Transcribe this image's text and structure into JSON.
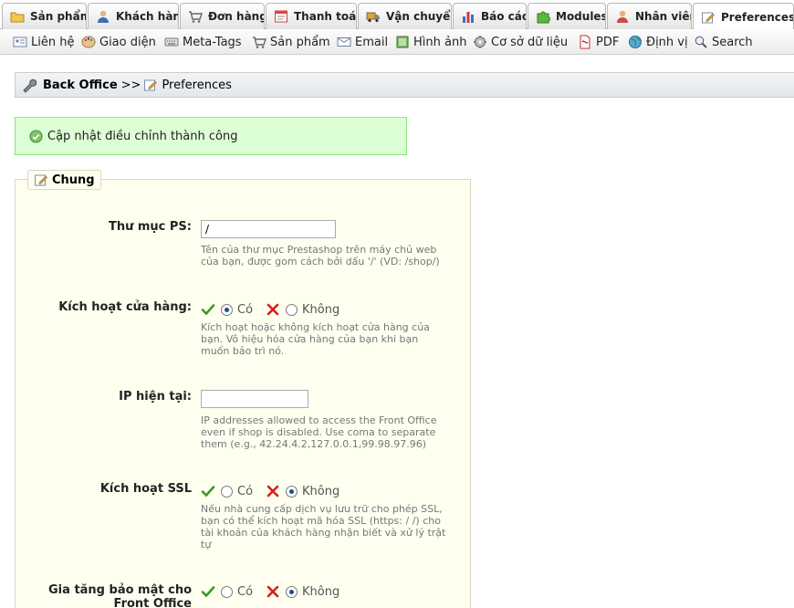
{
  "tabs": [
    {
      "label": "Sản phẩm",
      "icon": "folder-icon"
    },
    {
      "label": "Khách hàng",
      "icon": "customer-icon"
    },
    {
      "label": "Đơn hàng",
      "icon": "cart-icon"
    },
    {
      "label": "Thanh toán",
      "icon": "payment-icon"
    },
    {
      "label": "Vận chuyển",
      "icon": "truck-icon"
    },
    {
      "label": "Báo cáo",
      "icon": "chart-icon"
    },
    {
      "label": "Modules",
      "icon": "puzzle-icon"
    },
    {
      "label": "Nhân viên",
      "icon": "employee-icon"
    },
    {
      "label": "Preferences",
      "icon": "preferences-icon",
      "active": true
    }
  ],
  "submenu": [
    {
      "label": "Liên hệ",
      "icon": "contact-icon"
    },
    {
      "label": "Giao diện",
      "icon": "palette-icon"
    },
    {
      "label": "Meta-Tags",
      "icon": "keyboard-icon"
    },
    {
      "label": "Sản phẩm",
      "icon": "cart-icon"
    },
    {
      "label": "Email",
      "icon": "email-icon"
    },
    {
      "label": "Hình ảnh",
      "icon": "image-icon"
    },
    {
      "label": "Cơ sở dữ liệu",
      "icon": "database-icon"
    },
    {
      "label": "PDF",
      "icon": "pdf-icon"
    },
    {
      "label": "Định vị",
      "icon": "globe-icon"
    },
    {
      "label": "Search",
      "icon": "search-icon"
    }
  ],
  "breadcrumb": {
    "root": "Back Office",
    "separator": ">>",
    "current": "Preferences"
  },
  "success_message": "Cập nhật điều chỉnh thành công",
  "fieldset": {
    "legend": "Chung",
    "rows": {
      "ps_dir": {
        "label": "Thư mục PS:",
        "value": "/",
        "hint_1": "Tên của thư mục Prestashop trên máy chủ web",
        "hint_2": "của bạn, được gom cách bởi dấu '/' (VD: /shop/)"
      },
      "shop_enable": {
        "label": "Kích hoạt cửa hàng:",
        "yes": "Có",
        "no": "Không",
        "selected": "yes",
        "hint_1": "Kích hoạt hoặc không kích hoạt cửa hàng của",
        "hint_2": "bạn. Vô hiệu hóa cửa hàng của bạn khi bạn",
        "hint_3": "muốn bảo trì nó."
      },
      "current_ip": {
        "label": "IP hiện tại:",
        "value": "",
        "hint_1": "IP addresses allowed to access the Front Office",
        "hint_2": "even if shop is disabled. Use coma to separate",
        "hint_3": "them (e.g., 42.24.4.2,127.0.0.1,99.98.97.96)"
      },
      "ssl": {
        "label": "Kích hoạt SSL",
        "yes": "Có",
        "no": "Không",
        "selected": "no",
        "hint_1": "Nếu nhà cung cấp dịch vụ lưu trữ cho phép SSL,",
        "hint_2": "bạn có thể kích hoạt mã hóa SSL (https: / /) cho",
        "hint_3": "tài khoản của khách hàng nhận biết và xử lý trật",
        "hint_4": "tự"
      },
      "front_security": {
        "label_1": "Gia tăng bảo mật cho",
        "label_2": "Front Office",
        "yes": "Có",
        "no": "Không",
        "selected": "no"
      }
    }
  },
  "colors": {
    "success_bg": "#ddffd5",
    "success_border": "#8ee081",
    "fieldset_bg": "#fffff0",
    "check_green": "#3a9a1e",
    "cross_red": "#d21f1f"
  }
}
